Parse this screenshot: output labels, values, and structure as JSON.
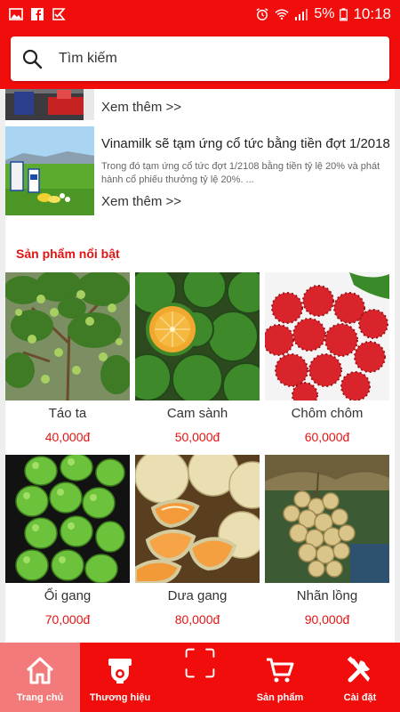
{
  "status_bar": {
    "battery": "5%",
    "time": "10:18",
    "left_icons": [
      "image-icon",
      "facebook-icon",
      "checkmark-notification-icon"
    ],
    "right_icons": [
      "alarm-icon",
      "wifi-icon",
      "signal-icon",
      "battery-icon"
    ]
  },
  "search": {
    "placeholder": "Tìm kiếm"
  },
  "news": {
    "items": [
      {
        "title": "",
        "description": "",
        "more_label": "Xem thêm  >>"
      },
      {
        "title": "Vinamilk sẽ tạm ứng cổ tức bằng tiền đợt 1/2018",
        "description": "Trong đó tạm ứng cổ tức đợt 1/2108 bằng tiền tỷ lệ 20% và phát hành cổ phiếu thưởng tỷ lệ 20%. ...",
        "more_label": "Xem thêm  >>"
      }
    ]
  },
  "products": {
    "section_title": "Sản phẩm nổi bật",
    "items": [
      {
        "name": "Táo ta",
        "price": "40,000đ"
      },
      {
        "name": "Cam sành",
        "price": "50,000đ"
      },
      {
        "name": "Chôm chôm",
        "price": "60,000đ"
      },
      {
        "name": "Ổi gang",
        "price": "70,000đ"
      },
      {
        "name": "Dưa gang",
        "price": "80,000đ"
      },
      {
        "name": "Nhãn lồng",
        "price": "90,000đ"
      }
    ]
  },
  "bottom_nav": {
    "items": [
      {
        "label": "Trang chủ",
        "icon": "home-icon",
        "active": true
      },
      {
        "label": "Thương hiệu",
        "icon": "brand-camera-icon",
        "active": false
      },
      {
        "label": "",
        "icon": "scan-icon",
        "active": false
      },
      {
        "label": "Sản phẩm",
        "icon": "cart-icon",
        "active": false
      },
      {
        "label": "Cài đặt",
        "icon": "settings-tools-icon",
        "active": false
      }
    ]
  },
  "colors": {
    "primary": "#f20d0d",
    "active_tab": "#f27a7a",
    "price": "#e31414"
  }
}
